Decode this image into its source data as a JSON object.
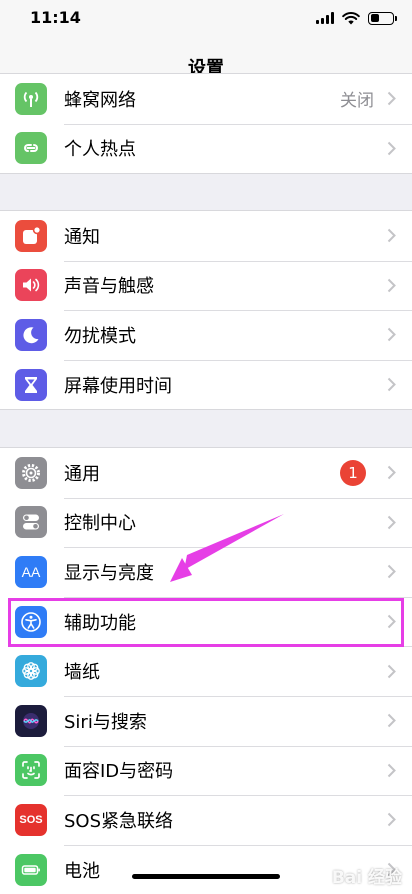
{
  "status": {
    "time": "11:14"
  },
  "nav": {
    "title": "设置"
  },
  "group1": [
    {
      "label": "蜂窝网络",
      "value": "关闭",
      "icon": "antenna-icon",
      "color": "#65c466"
    },
    {
      "label": "个人热点",
      "icon": "hotspot-icon",
      "color": "#65c466"
    }
  ],
  "group2": [
    {
      "label": "通知",
      "icon": "notification-icon",
      "color": "#eb4d3d"
    },
    {
      "label": "声音与触感",
      "icon": "speaker-icon",
      "color": "#eb445a"
    },
    {
      "label": "勿扰模式",
      "icon": "moon-icon",
      "color": "#5e5ce6"
    },
    {
      "label": "屏幕使用时间",
      "icon": "hourglass-icon",
      "color": "#5e5ce6"
    }
  ],
  "group3": [
    {
      "label": "通用",
      "badge": "1",
      "icon": "gear-icon",
      "color": "#8e8e93"
    },
    {
      "label": "控制中心",
      "icon": "toggles-icon",
      "color": "#8e8e93"
    },
    {
      "label": "显示与亮度",
      "icon": "text-size-icon",
      "color": "#2f7cf6"
    },
    {
      "label": "辅助功能",
      "icon": "accessibility-icon",
      "color": "#2f7cf6"
    },
    {
      "label": "墙纸",
      "icon": "flower-icon",
      "color": "#35aadc"
    },
    {
      "label": "Siri与搜索",
      "icon": "siri-icon",
      "color": "#1c1c3c"
    },
    {
      "label": "面容ID与密码",
      "icon": "face-id-icon",
      "color": "#4cc764"
    },
    {
      "label": "SOS紧急联络",
      "icon": "sos-icon",
      "color": "#e5322d"
    },
    {
      "label": "电池",
      "icon": "battery-icon",
      "color": "#4cc764"
    }
  ],
  "icon_glyphs": {
    "sos": "SOS",
    "text_size": "AA"
  },
  "annotation": {
    "highlight_color": "#e63ee6"
  },
  "watermark": "Bai 经验"
}
